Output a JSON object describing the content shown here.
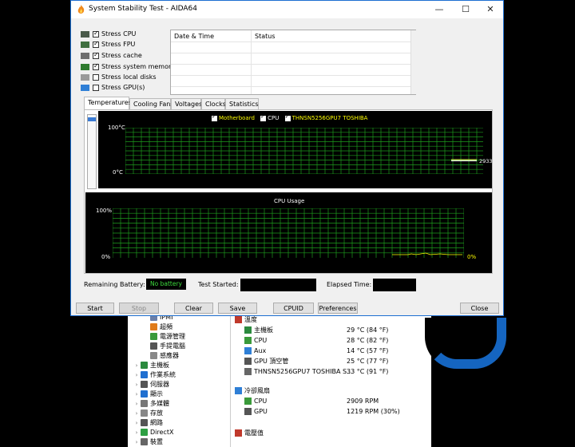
{
  "window": {
    "title": "System Stability Test - AIDA64",
    "minimize_glyph": "—",
    "maximize_glyph": "☐",
    "close_glyph": "✕"
  },
  "options": [
    {
      "label": "Stress CPU",
      "checked": true,
      "icon": "cpu-icon"
    },
    {
      "label": "Stress FPU",
      "checked": true,
      "icon": "fpu-icon"
    },
    {
      "label": "Stress cache",
      "checked": true,
      "icon": "cache-icon"
    },
    {
      "label": "Stress system memory",
      "checked": true,
      "icon": "memory-icon"
    },
    {
      "label": "Stress local disks",
      "checked": false,
      "icon": "disk-icon"
    },
    {
      "label": "Stress GPU(s)",
      "checked": false,
      "icon": "gpu-icon"
    }
  ],
  "log": {
    "col_date": "Date & Time",
    "col_status": "Status"
  },
  "tabs": [
    "Temperatures",
    "Cooling Fans",
    "Voltages",
    "Clocks",
    "Statistics"
  ],
  "temp_chart": {
    "legend": [
      "Motherboard",
      "CPU",
      "THNSN5256GPU7 TOSHIBA"
    ],
    "y_top": "100°C",
    "y_bottom": "0°C",
    "readout": "2933"
  },
  "cpu_chart": {
    "title": "CPU Usage",
    "y_top": "100%",
    "y_bottom": "0%",
    "readout": "0%"
  },
  "status": {
    "battery_label": "Remaining Battery:",
    "battery_value": "No battery",
    "started_label": "Test Started:",
    "elapsed_label": "Elapsed Time:"
  },
  "buttons": {
    "start": "Start",
    "stop": "Stop",
    "clear": "Clear",
    "save": "Save",
    "cpuid": "CPUID",
    "preferences": "Preferences",
    "close": "Close"
  },
  "bg_tree": [
    {
      "label": "IPMI",
      "glyph": "",
      "indent": 2,
      "color": "#6b7fa8"
    },
    {
      "label": "超頻",
      "glyph": "",
      "indent": 2,
      "color": "#e07b1a"
    },
    {
      "label": "電源管理",
      "glyph": "",
      "indent": 2,
      "color": "#3a9a3a"
    },
    {
      "label": "手提電腦",
      "glyph": "",
      "indent": 2,
      "color": "#555555"
    },
    {
      "label": "感應器",
      "glyph": "",
      "indent": 2,
      "color": "#888888"
    },
    {
      "label": "主機板",
      "glyph": "›",
      "indent": 1,
      "color": "#2b8a3e"
    },
    {
      "label": "作業系統",
      "glyph": "›",
      "indent": 1,
      "color": "#1f6fd0"
    },
    {
      "label": "伺服器",
      "glyph": "›",
      "indent": 1,
      "color": "#555555"
    },
    {
      "label": "顯示",
      "glyph": "›",
      "indent": 1,
      "color": "#1f6fd0"
    },
    {
      "label": "多媒體",
      "glyph": "›",
      "indent": 1,
      "color": "#777777"
    },
    {
      "label": "存放",
      "glyph": "›",
      "indent": 1,
      "color": "#888888"
    },
    {
      "label": "網路",
      "glyph": "›",
      "indent": 1,
      "color": "#555555"
    },
    {
      "label": "DirectX",
      "glyph": "›",
      "indent": 1,
      "color": "#2ea043"
    },
    {
      "label": "裝置",
      "glyph": "›",
      "indent": 1,
      "color": "#666666"
    }
  ],
  "bg_sensors": [
    {
      "label": "溫度",
      "value": "",
      "header": true,
      "color": "#c0392b"
    },
    {
      "label": "主機板",
      "value": "29 °C  (84 °F)",
      "header": false,
      "color": "#2b8a3e"
    },
    {
      "label": "CPU",
      "value": "28 °C  (82 °F)",
      "header": false,
      "color": "#3a9a3a"
    },
    {
      "label": "Aux",
      "value": "14 °C  (57 °F)",
      "header": false,
      "color": "#2f7fd6"
    },
    {
      "label": "GPU 頂空管",
      "value": "25 °C  (77 °F)",
      "header": false,
      "color": "#555555"
    },
    {
      "label": "THNSN5256GPU7 TOSHIBA S...",
      "value": "33 °C  (91 °F)",
      "header": false,
      "color": "#666666"
    },
    {
      "label": "冷卻風扇",
      "value": "",
      "header": true,
      "color": "#2f7fd6"
    },
    {
      "label": "CPU",
      "value": "2909 RPM",
      "header": false,
      "color": "#3a9a3a"
    },
    {
      "label": "GPU",
      "value": "1219 RPM  (30%)",
      "header": false,
      "color": "#555555"
    },
    {
      "label": "電壓值",
      "value": "",
      "header": true,
      "color": "#c0392b"
    }
  ]
}
